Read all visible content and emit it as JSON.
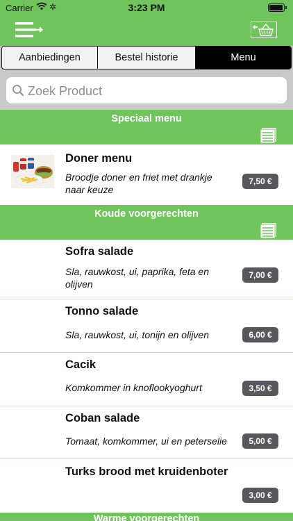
{
  "status_bar": {
    "carrier": "Carrier",
    "time": "3:23 PM"
  },
  "header": {
    "menu_icon": "menu-arrow-icon",
    "basket_icon": "basket-return-icon"
  },
  "tabs": [
    {
      "label": "Aanbiedingen",
      "active": false
    },
    {
      "label": "Bestel historie",
      "active": false
    },
    {
      "label": "Menu",
      "active": true
    }
  ],
  "search": {
    "placeholder": "Zoek Product",
    "value": ""
  },
  "colors": {
    "accent_green": "#6fc45c",
    "price_badge": "#58585c",
    "tab_active": "#000000"
  },
  "sections": [
    {
      "title": "Speciaal menu",
      "icon": "list-icon",
      "items": [
        {
          "name": "Doner menu",
          "description": "Broodje doner en friet met drankje naar keuze",
          "price": "7,50 €",
          "image": "doner-menu-photo"
        }
      ]
    },
    {
      "title": "Koude voorgerechten",
      "icon": "list-icon",
      "items": [
        {
          "name": "Sofra salade",
          "description": "Sla, rauwkost, ui, paprika, feta en olijven",
          "price": "7,00 €"
        },
        {
          "name": "Tonno salade",
          "description": "Sla, rauwkost, ui, tonijn en olijven",
          "price": "6,00 €"
        },
        {
          "name": "Cacik",
          "description": "Komkommer in knoflookyoghurt",
          "price": "3,50 €"
        },
        {
          "name": "Coban salade",
          "description": "Tomaat, komkommer, ui en peterselie",
          "price": "5,00 €"
        },
        {
          "name": "Turks brood met kruidenboter",
          "description": "",
          "price": "3,00 €"
        }
      ]
    },
    {
      "title": "Warme voorgerechten",
      "icon": "list-icon",
      "items": []
    }
  ]
}
